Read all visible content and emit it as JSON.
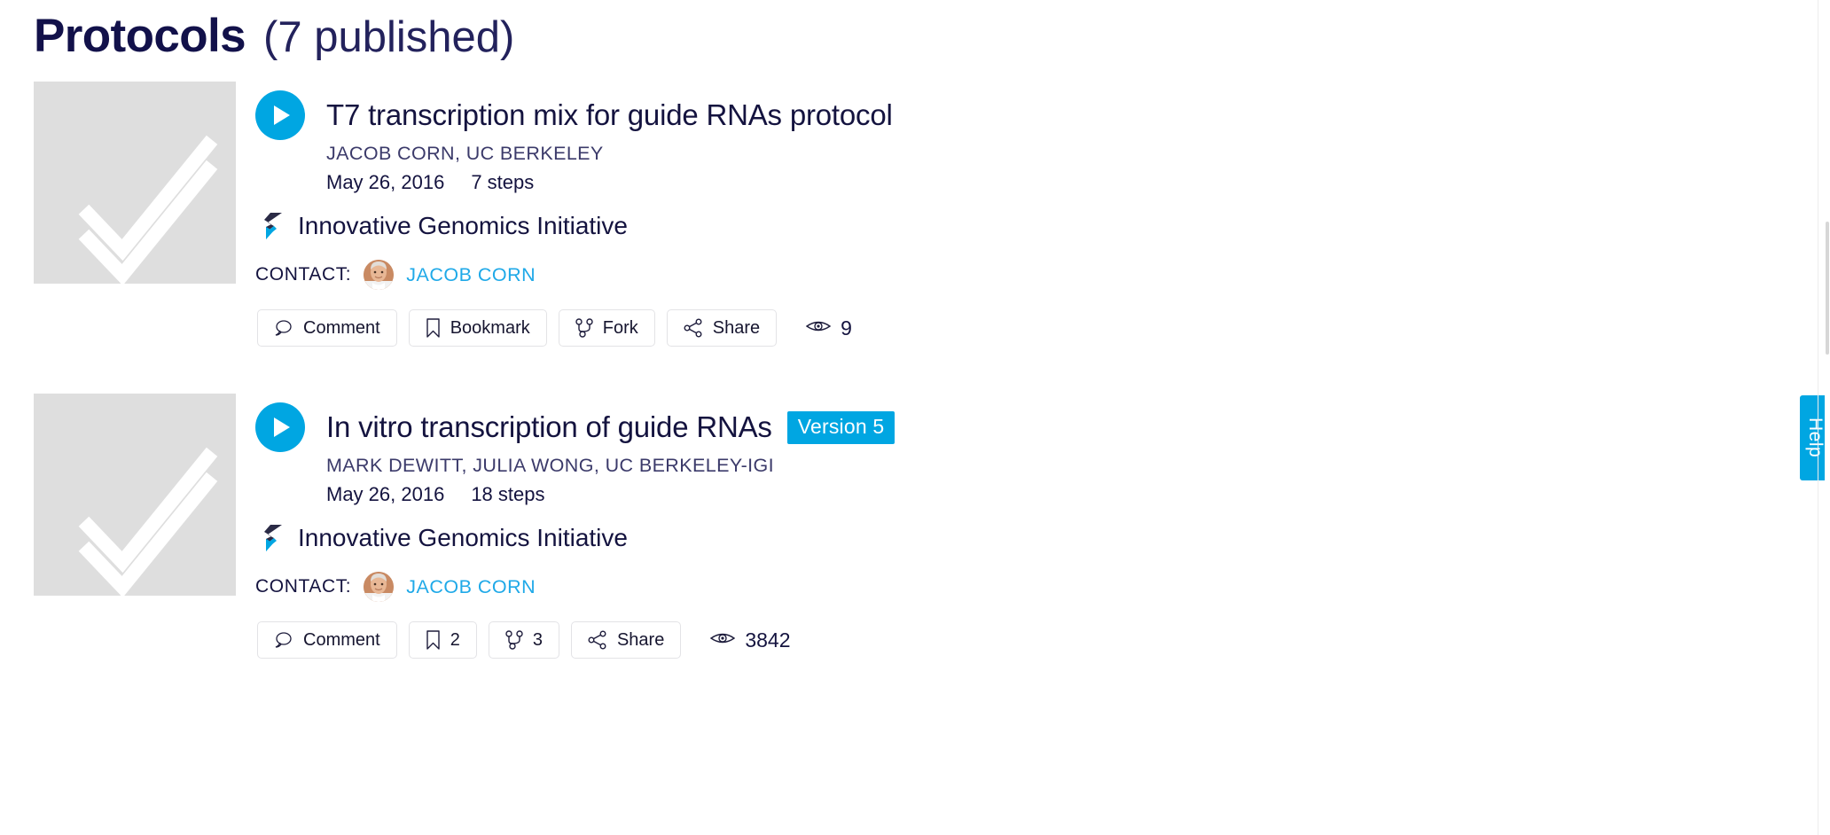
{
  "header": {
    "title": "Protocols",
    "count_label": "(7 published)"
  },
  "colors": {
    "accent_cyan": "#00a6e2",
    "link_cyan": "#1fa9e8",
    "title_navy": "#14133f",
    "thumb_gray": "#dedede",
    "button_border": "#e3e3e6"
  },
  "protocols": [
    {
      "thumbnail_icon": "checkmark-icon",
      "play_icon": "play-icon",
      "title": "T7 transcription mix for guide RNAs protocol",
      "version_badge": "",
      "authors": "JACOB CORN, UC BERKELEY",
      "date": "May 26, 2016",
      "steps": "7 steps",
      "org_logo_icon": "protocols-bolt-icon",
      "org_name": "Innovative Genomics Initiative",
      "contact_label": "CONTACT:",
      "contact_avatar_icon": "avatar",
      "contact_name": "JACOB CORN",
      "actions": [
        {
          "icon": "comment-icon",
          "label": "Comment"
        },
        {
          "icon": "bookmark-icon",
          "label": "Bookmark"
        },
        {
          "icon": "fork-icon",
          "label": "Fork"
        },
        {
          "icon": "share-icon",
          "label": "Share"
        }
      ],
      "views_icon": "eye-icon",
      "views": "9"
    },
    {
      "thumbnail_icon": "checkmark-icon",
      "play_icon": "play-icon",
      "title": "In vitro transcription of guide RNAs",
      "version_badge": "Version 5",
      "authors": "MARK DEWITT, JULIA WONG, UC BERKELEY-IGI",
      "date": "May 26, 2016",
      "steps": "18 steps",
      "org_logo_icon": "protocols-bolt-icon",
      "org_name": "Innovative Genomics Initiative",
      "contact_label": "CONTACT:",
      "contact_avatar_icon": "avatar",
      "contact_name": "JACOB CORN",
      "actions": [
        {
          "icon": "comment-icon",
          "label": "Comment"
        },
        {
          "icon": "bookmark-icon",
          "label": "2"
        },
        {
          "icon": "fork-icon",
          "label": "3"
        },
        {
          "icon": "share-icon",
          "label": "Share"
        }
      ],
      "views_icon": "eye-icon",
      "views": "3842"
    }
  ],
  "help_tab": {
    "label": "Help"
  }
}
